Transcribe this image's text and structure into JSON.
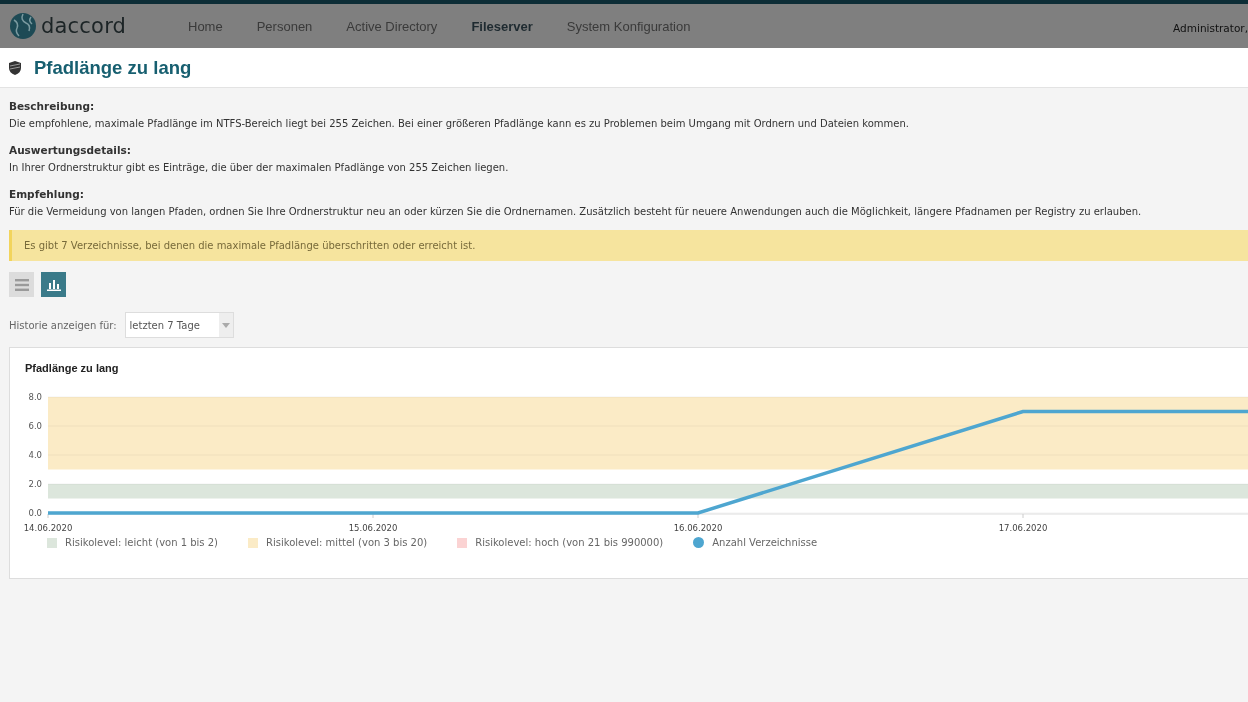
{
  "header": {
    "logo": "daccord",
    "nav": [
      {
        "label": "Home",
        "selected": false
      },
      {
        "label": "Personen",
        "selected": false
      },
      {
        "label": "Active Directory",
        "selected": false
      },
      {
        "label": "Fileserver",
        "selected": true
      },
      {
        "label": "System Konfiguration",
        "selected": false
      }
    ],
    "user": "Administrator,"
  },
  "page_title": "Pfadlänge zu lang",
  "sections": [
    {
      "heading": "Beschreibung:",
      "text": "Die empfohlene, maximale Pfadlänge im NTFS-Bereich liegt bei 255 Zeichen. Bei einer größeren Pfadlänge kann es zu Problemen beim Umgang mit Ordnern und Dateien kommen."
    },
    {
      "heading": "Auswertungsdetails:",
      "text": "In Ihrer Ordnerstruktur gibt es Einträge, die über der maximalen Pfadlänge von 255 Zeichen liegen."
    },
    {
      "heading": "Empfehlung:",
      "text": "Für die Vermeidung von langen Pfaden, ordnen Sie Ihre Ordnerstruktur neu an oder kürzen Sie die Ordnernamen. Zusätzlich besteht für neuere Anwendungen auch die Möglichkeit, längere Pfadnamen per Registry zu erlauben."
    }
  ],
  "alert": "Es gibt 7 Verzeichnisse, bei denen die maximale Pfadlänge überschritten oder erreicht ist.",
  "view_toggle": [
    {
      "kind": "list",
      "selected": false
    },
    {
      "kind": "chart",
      "selected": true
    }
  ],
  "history": {
    "label": "Historie anzeigen für:",
    "value": "letzten 7 Tage"
  },
  "chart_card": {
    "chart_data": {
      "type": "line",
      "title": "Pfadlänge zu lang",
      "categories": [
        "14.06.2020",
        "15.06.2020",
        "16.06.2020",
        "17.06.2020",
        null
      ],
      "series": [
        {
          "name": "Anzahl Verzeichnisse",
          "color": "#4ea6d0",
          "values": [
            0,
            0,
            0,
            7,
            7
          ]
        }
      ],
      "grid": true,
      "ylim": [
        0,
        8
      ],
      "yticks": [
        {
          "value": 0,
          "label": "0.0"
        },
        {
          "value": 2,
          "label": "2.0"
        },
        {
          "value": 4,
          "label": "4.0"
        },
        {
          "value": 6,
          "label": "6.0"
        },
        {
          "value": 8,
          "label": "8.0"
        }
      ],
      "bands": [
        {
          "axis": "y",
          "from": 1,
          "to": 2,
          "color": "#dce6dc"
        },
        {
          "axis": "y",
          "from": 3,
          "to": 20,
          "color": "#fbebc6"
        }
      ]
    },
    "legend": [
      {
        "label": "Risikolevel: leicht (von 1 bis 2)",
        "color": "#dce6dc"
      },
      {
        "label": "Risikolevel: mittel (von 3 bis 20)",
        "color": "#fbebc6"
      },
      {
        "label": "Risikolevel: hoch (von 21 bis 990000)",
        "color": "#fbd3d3"
      }
    ]
  }
}
